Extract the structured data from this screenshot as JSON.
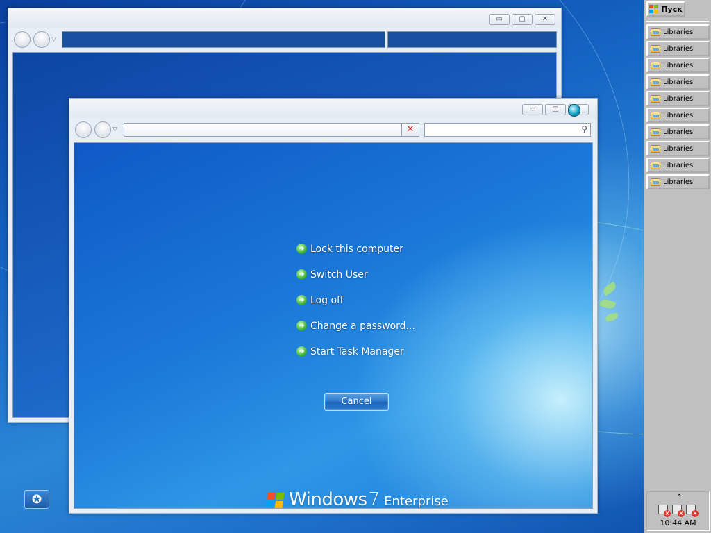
{
  "security_screen": {
    "options": [
      {
        "label": "Lock this computer"
      },
      {
        "label": "Switch User"
      },
      {
        "label": "Log off"
      },
      {
        "label": "Change a password..."
      },
      {
        "label": "Start Task Manager"
      }
    ],
    "cancel_label": "Cancel"
  },
  "branding": {
    "word": "Windows",
    "version": "7",
    "edition": "Enterprise"
  },
  "front_window": {
    "address_value": "",
    "search_value": "",
    "stop_glyph": "✕",
    "dropdown_glyph": "▾",
    "search_glyph": "⚲"
  },
  "caption": {
    "minimize": "▭",
    "maximize": "▢",
    "close": "✕"
  },
  "taskbar": {
    "start_label": "Пуск",
    "items": [
      {
        "label": "Libraries",
        "icon": "folder-icon"
      },
      {
        "label": "Libraries",
        "icon": "folder-icon"
      },
      {
        "label": "Libraries",
        "icon": "folder-icon"
      },
      {
        "label": "Libraries",
        "icon": "folder-icon"
      },
      {
        "label": "Libraries",
        "icon": "folder-icon"
      },
      {
        "label": "Libraries",
        "icon": "folder-icon"
      },
      {
        "label": "Libraries",
        "icon": "folder-icon"
      },
      {
        "label": "Libraries",
        "icon": "folder-icon"
      },
      {
        "label": "Libraries",
        "icon": "folder-icon"
      },
      {
        "label": "Libraries",
        "icon": "folder-icon"
      }
    ],
    "tray": {
      "chevron": "⌃",
      "clock": "10:44 AM",
      "icons": [
        "action-center-warning-icon",
        "network-disconnected-icon",
        "volume-muted-icon"
      ]
    }
  },
  "ease_of_access": {
    "glyph": "✪"
  },
  "colors": {
    "accent_green": "#3fb43a",
    "warning_red": "#e03a2f",
    "desktop_blue": "#1565c4"
  }
}
